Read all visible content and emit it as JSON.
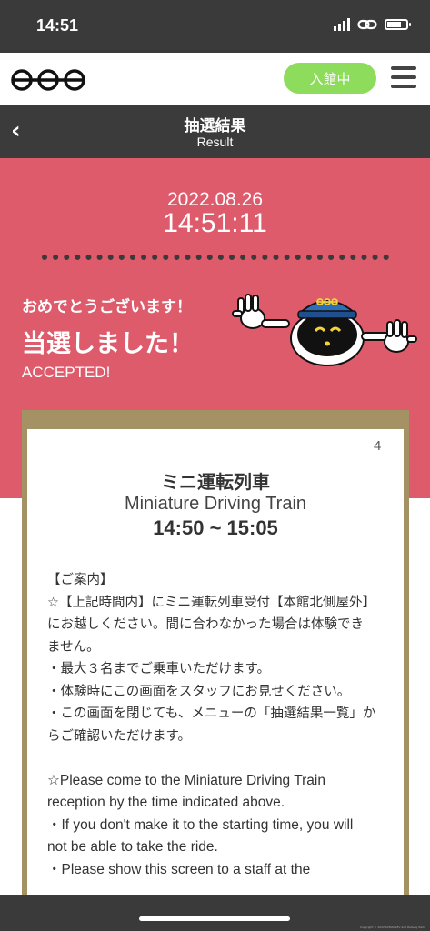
{
  "status_bar": {
    "time": "14:51"
  },
  "header": {
    "entry_label": "入館中"
  },
  "titlebar": {
    "title_jp": "抽選結果",
    "title_en": "Result"
  },
  "result": {
    "date": "2022.08.26",
    "time": "14:51:11",
    "congrats": "おめでとうございます！",
    "won": "当選しました！",
    "accepted": "ACCEPTED!"
  },
  "ticket": {
    "number": "4",
    "title_jp": "ミニ運転列車",
    "title_en": "Miniature Driving Train",
    "time_range": "14:50 ~ 15:05",
    "guide_heading": "【ご案内】",
    "guide_jp": [
      "☆【上記時間内】にミニ運転列車受付【本館北側屋外】にお越しください。間に合わなかった場合は体験できません。",
      "・最大３名までご乗車いただけます。",
      "・体験時にこの画面をスタッフにお見せください。",
      "・この画面を閉じても、メニューの「抽選結果一覧」からご確認いただけます。"
    ],
    "guide_en": [
      "☆Please come to the Miniature Driving Train reception by the time indicated above.",
      "・If you don't make it to the starting time, you will not be able to take the ride.",
      "・Please show this screen to a staff at the"
    ]
  },
  "footer": {
    "copyright": "Copyright © 2022 SCMAGLEV and Railway Park"
  },
  "colors": {
    "accent_pink": "#de5b6c",
    "entry_green": "#8edc5b",
    "frame_gold": "#a49164",
    "dark": "#3a3a3a"
  }
}
